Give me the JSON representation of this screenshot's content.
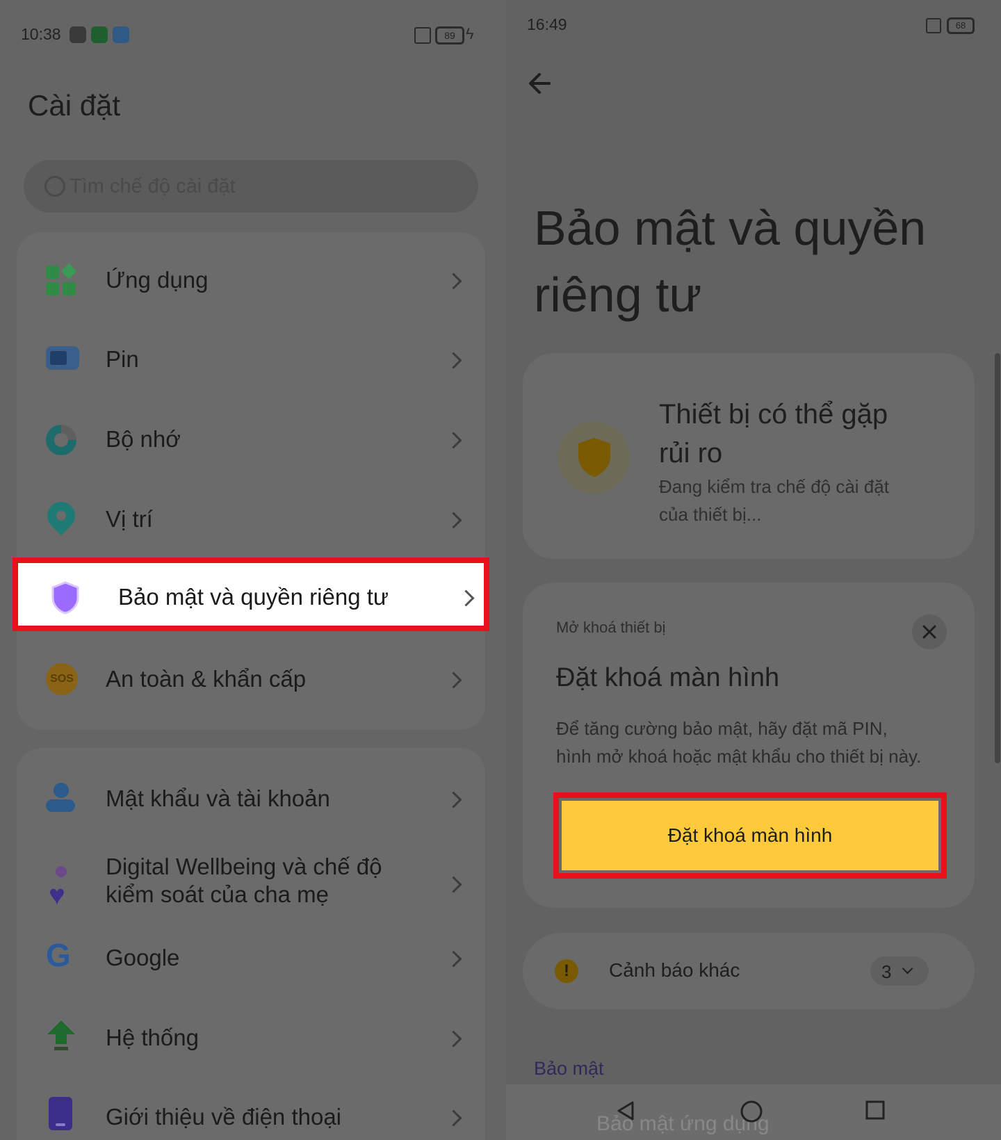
{
  "left": {
    "status": {
      "time": "10:38",
      "battery": "89"
    },
    "title": "Cài đặt",
    "search": {
      "placeholder": "Tìm chế độ cài đặt"
    },
    "group1": [
      {
        "label": "Ứng dụng",
        "icon": "apps-icon"
      },
      {
        "label": "Pin",
        "icon": "battery-icon"
      },
      {
        "label": "Bộ nhớ",
        "icon": "storage-icon"
      },
      {
        "label": "Vị trí",
        "icon": "location-icon"
      },
      {
        "label": "Bảo mật và quyền riêng tư",
        "icon": "shield-icon"
      },
      {
        "label": "An toàn & khẩn cấp",
        "icon": "sos-icon"
      }
    ],
    "group2": [
      {
        "label": "Mật khẩu và tài khoản",
        "icon": "account-icon"
      },
      {
        "label": "Digital Wellbeing và chế độ",
        "label2": "kiểm soát của cha mẹ",
        "icon": "wellbeing-icon"
      },
      {
        "label": "Google",
        "icon": "google-icon"
      },
      {
        "label": "Hệ thống",
        "icon": "system-icon"
      },
      {
        "label": "Giới thiệu về điện thoại",
        "icon": "phone-icon"
      }
    ]
  },
  "right": {
    "status": {
      "time": "16:49",
      "battery": "68"
    },
    "title_line1": "Bảo mật và quyền",
    "title_line2": "riêng tư",
    "risk_card": {
      "title_line1": "Thiết bị có thể gặp",
      "title_line2": "rủi ro",
      "subtitle_line1": "Đang kiểm tra chế độ cài đặt",
      "subtitle_line2": "của thiết bị..."
    },
    "unlock_card": {
      "overline": "Mở khoá thiết bị",
      "title": "Đặt khoá màn hình",
      "body_line1": "Để tăng cường bảo mật, hãy đặt mã PIN,",
      "body_line2": "hình mở khoá hoặc mật khẩu cho thiết bị này.",
      "button": "Đặt khoá màn hình"
    },
    "other_warnings": {
      "label": "Cảnh báo khác",
      "count": "3"
    },
    "section_header": "Bảo mật",
    "partial_item": "Bảo mật ứng dụng"
  },
  "colors": {
    "highlight_border": "#e8101a",
    "button_yellow": "#fcca3b",
    "shield_purple": "#9b6bff",
    "shield_gold": "#b8860b"
  }
}
